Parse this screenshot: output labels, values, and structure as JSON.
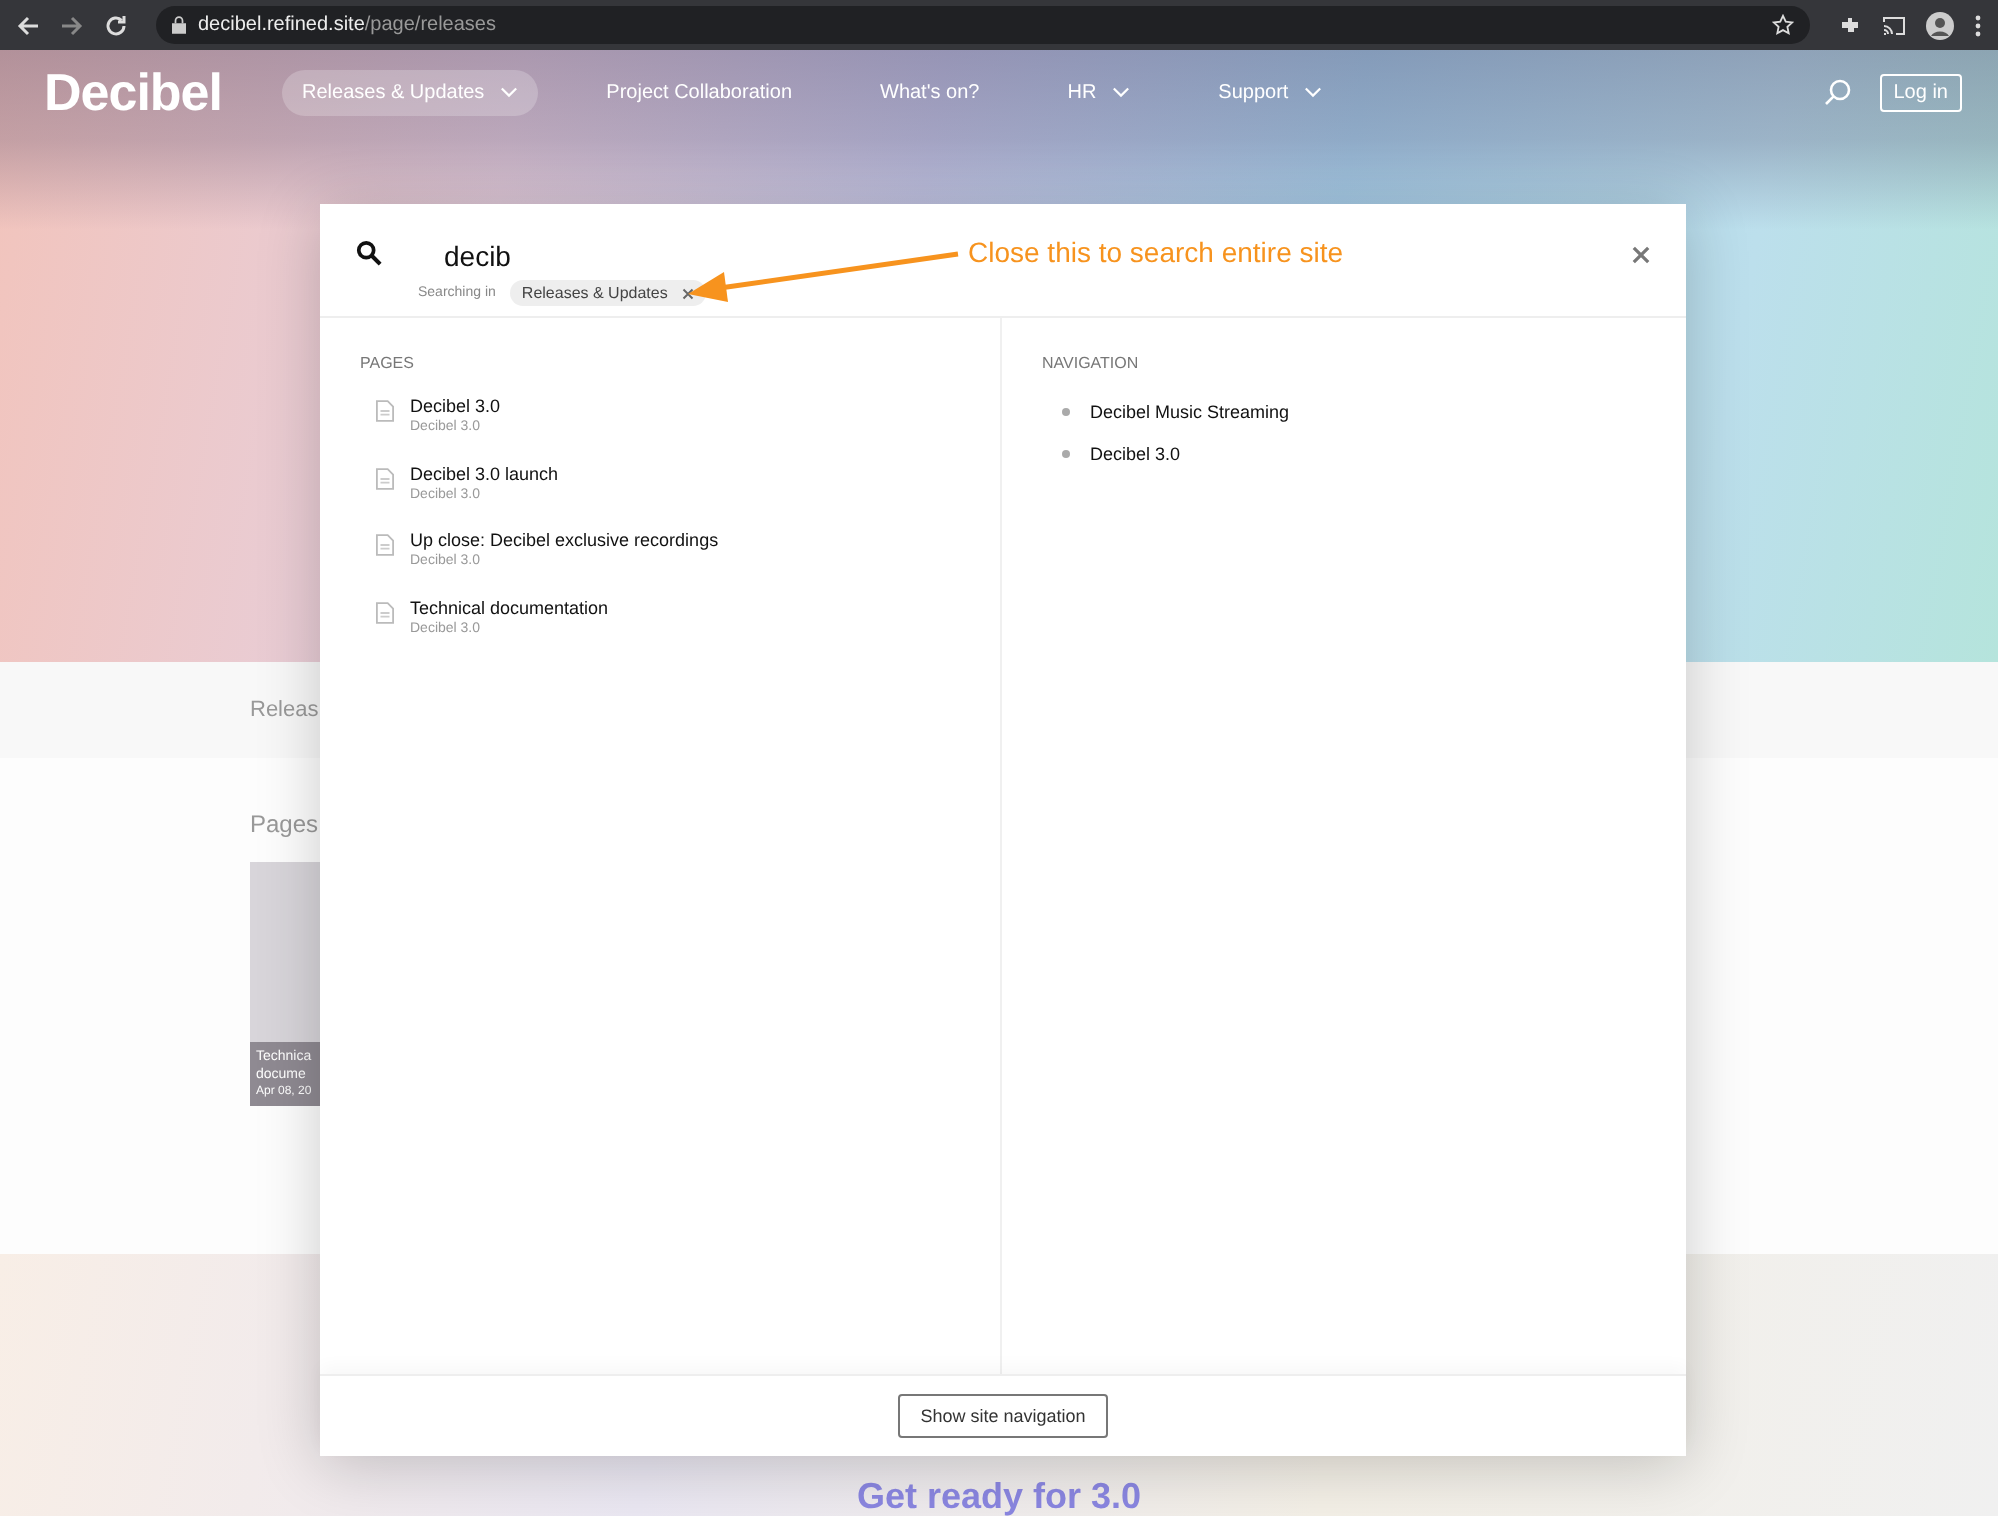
{
  "browser": {
    "url_host": "decibel.refined.site",
    "url_path": "/page/releases"
  },
  "site": {
    "logo": "Decibel",
    "nav": [
      {
        "label": "Releases & Updates",
        "selected": true,
        "has_menu": true
      },
      {
        "label": "Project Collaboration",
        "selected": false,
        "has_menu": false
      },
      {
        "label": "What's on?",
        "selected": false,
        "has_menu": false
      },
      {
        "label": "HR",
        "selected": false,
        "has_menu": true
      },
      {
        "label": "Support",
        "selected": false,
        "has_menu": true
      }
    ],
    "login": "Log in"
  },
  "background": {
    "breadcrumb": "Releas",
    "section_title": "Pages",
    "card_title": "Technica docume",
    "card_date": "Apr 08, 20",
    "banner": "Get ready for 3.0"
  },
  "search": {
    "query": "decib",
    "scope_label": "Searching in",
    "scope_chip": "Releases & Updates",
    "annotation": "Close this to search entire site",
    "pages_heading": "PAGES",
    "pages": [
      {
        "title": "Decibel 3.0",
        "space": "Decibel 3.0"
      },
      {
        "title": "Decibel 3.0 launch",
        "space": "Decibel 3.0"
      },
      {
        "title": "Up close: Decibel exclusive recordings",
        "space": "Decibel 3.0"
      },
      {
        "title": "Technical documentation",
        "space": "Decibel 3.0"
      }
    ],
    "navigation_heading": "NAVIGATION",
    "navigation": [
      {
        "title": "Decibel Music Streaming"
      },
      {
        "title": "Decibel 3.0"
      }
    ],
    "footer_button": "Show site navigation"
  }
}
